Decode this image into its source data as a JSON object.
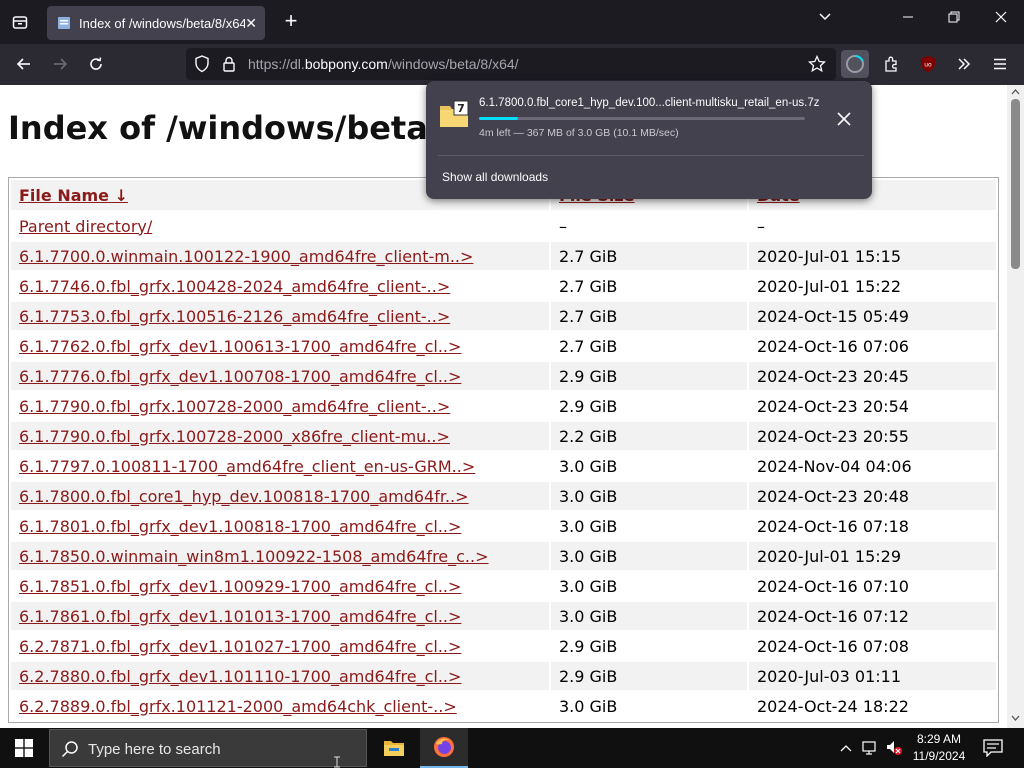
{
  "browser": {
    "tab": {
      "title": "Index of /windows/beta/8/x64/"
    },
    "url": {
      "prefix": "https://dl.",
      "host": "bobpony.com",
      "path": "/windows/beta/8/x64/"
    }
  },
  "page": {
    "title": "Index of /windows/beta/8/x64/",
    "headers": {
      "name": "File Name ↓",
      "size": "File Size",
      "date": "Date"
    },
    "parent": {
      "name": "Parent directory/",
      "size": "–",
      "date": "–"
    },
    "rows": [
      {
        "name": "6.1.7700.0.winmain.100122-1900_amd64fre_client-m..>",
        "size": "2.7 GiB",
        "date": "2020-Jul-01 15:15"
      },
      {
        "name": "6.1.7746.0.fbl_grfx.100428-2024_amd64fre_client-..>",
        "size": "2.7 GiB",
        "date": "2020-Jul-01 15:22"
      },
      {
        "name": "6.1.7753.0.fbl_grfx.100516-2126_amd64fre_client-..>",
        "size": "2.7 GiB",
        "date": "2024-Oct-15 05:49"
      },
      {
        "name": "6.1.7762.0.fbl_grfx_dev1.100613-1700_amd64fre_cl..>",
        "size": "2.7 GiB",
        "date": "2024-Oct-16 07:06"
      },
      {
        "name": "6.1.7776.0.fbl_grfx_dev1.100708-1700_amd64fre_cl..>",
        "size": "2.9 GiB",
        "date": "2024-Oct-23 20:45"
      },
      {
        "name": "6.1.7790.0.fbl_grfx.100728-2000_amd64fre_client-..>",
        "size": "2.9 GiB",
        "date": "2024-Oct-23 20:54"
      },
      {
        "name": "6.1.7790.0.fbl_grfx.100728-2000_x86fre_client-mu..>",
        "size": "2.2 GiB",
        "date": "2024-Oct-23 20:55"
      },
      {
        "name": "6.1.7797.0.100811-1700_amd64fre_client_en-us-GRM..>",
        "size": "3.0 GiB",
        "date": "2024-Nov-04 04:06"
      },
      {
        "name": "6.1.7800.0.fbl_core1_hyp_dev.100818-1700_amd64fr..>",
        "size": "3.0 GiB",
        "date": "2024-Oct-23 20:48"
      },
      {
        "name": "6.1.7801.0.fbl_grfx_dev1.100818-1700_amd64fre_cl..>",
        "size": "3.0 GiB",
        "date": "2024-Oct-16 07:18"
      },
      {
        "name": "6.1.7850.0.winmain_win8m1.100922-1508_amd64fre_c..>",
        "size": "3.0 GiB",
        "date": "2020-Jul-01 15:29"
      },
      {
        "name": "6.1.7851.0.fbl_grfx_dev1.100929-1700_amd64fre_cl..>",
        "size": "3.0 GiB",
        "date": "2024-Oct-16 07:10"
      },
      {
        "name": "6.1.7861.0.fbl_grfx_dev1.101013-1700_amd64fre_cl..>",
        "size": "3.0 GiB",
        "date": "2024-Oct-16 07:12"
      },
      {
        "name": "6.2.7871.0.fbl_grfx_dev1.101027-1700_amd64fre_cl..>",
        "size": "2.9 GiB",
        "date": "2024-Oct-16 07:08"
      },
      {
        "name": "6.2.7880.0.fbl_grfx_dev1.101110-1700_amd64fre_cl..>",
        "size": "2.9 GiB",
        "date": "2020-Jul-03 01:11"
      },
      {
        "name": "6.2.7889.0.fbl_grfx.101121-2000_amd64chk_client-..>",
        "size": "3.0 GiB",
        "date": "2024-Oct-24 18:22"
      }
    ]
  },
  "downloads": {
    "file_name": "6.1.7800.0.fbl_core1_hyp_dev.100...client-multisku_retail_en-us.7z",
    "status": "4m left — 367 MB of 3.0 GB (10.1 MB/sec)",
    "progress": 0.12,
    "show_all": "Show all downloads"
  },
  "taskbar": {
    "search_placeholder": "Type here to search",
    "time": "8:29 AM",
    "date": "11/9/2024"
  },
  "colors": {
    "link": "#8b1a1a",
    "accent": "#00ddff"
  }
}
